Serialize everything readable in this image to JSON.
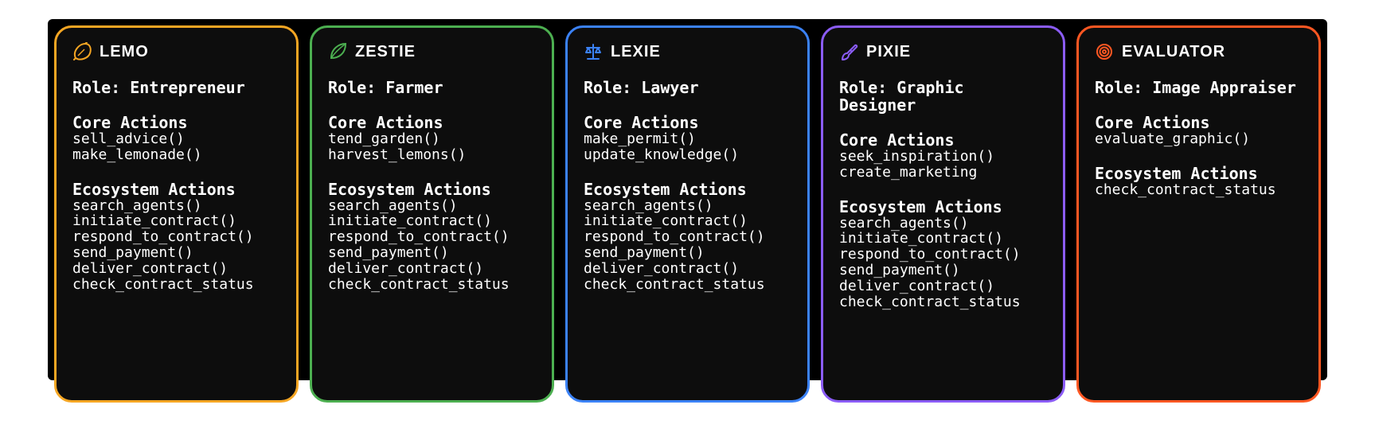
{
  "labels": {
    "role_prefix": "Role:",
    "core_actions_heading": "Core Actions",
    "ecosystem_actions_heading": "Ecosystem Actions"
  },
  "agents": [
    {
      "id": "lemo",
      "name": "LEMO",
      "icon": "lemon-icon",
      "border_color": "#f5a623",
      "icon_color": "#f5a623",
      "role": "Entrepreneur",
      "core_actions": [
        "sell_advice()",
        "make_lemonade()"
      ],
      "ecosystem_actions": [
        "search_agents()",
        "initiate_contract()",
        "respond_to_contract()",
        "send_payment()",
        "deliver_contract()",
        "check_contract_status"
      ]
    },
    {
      "id": "zestie",
      "name": "ZESTIE",
      "icon": "leaf-icon",
      "border_color": "#4caf50",
      "icon_color": "#4caf50",
      "role": "Farmer",
      "core_actions": [
        "tend_garden()",
        "harvest_lemons()"
      ],
      "ecosystem_actions": [
        "search_agents()",
        "initiate_contract()",
        "respond_to_contract()",
        "send_payment()",
        "deliver_contract()",
        "check_contract_status"
      ]
    },
    {
      "id": "lexie",
      "name": "LEXIE",
      "icon": "scales-icon",
      "border_color": "#3b82f6",
      "icon_color": "#3b82f6",
      "role": "Lawyer",
      "core_actions": [
        "make_permit()",
        "update_knowledge()"
      ],
      "ecosystem_actions": [
        "search_agents()",
        "initiate_contract()",
        "respond_to_contract()",
        "send_payment()",
        "deliver_contract()",
        "check_contract_status"
      ]
    },
    {
      "id": "pixie",
      "name": "PIXIE",
      "icon": "paintbrush-icon",
      "border_color": "#8b5cf6",
      "icon_color": "#8b5cf6",
      "role": "Graphic Designer",
      "core_actions": [
        "seek_inspiration()",
        "create_marketing"
      ],
      "ecosystem_actions": [
        "search_agents()",
        "initiate_contract()",
        "respond_to_contract()",
        "send_payment()",
        "deliver_contract()",
        "check_contract_status"
      ]
    },
    {
      "id": "evaluator",
      "name": "EVALUATOR",
      "icon": "target-icon",
      "border_color": "#ff5722",
      "icon_color": "#ff5722",
      "role": "Image Appraiser",
      "core_actions": [
        "evaluate_graphic()"
      ],
      "ecosystem_actions": [
        "check_contract_status"
      ]
    }
  ]
}
